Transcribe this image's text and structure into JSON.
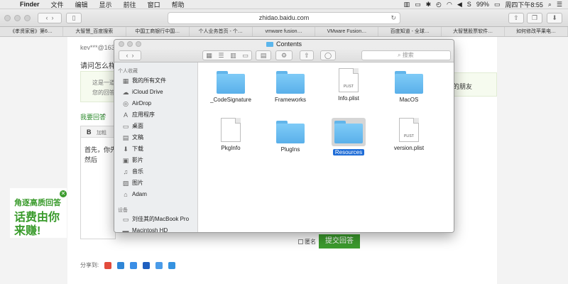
{
  "menubar": {
    "apple_icon": "apple-icon",
    "app_name": "Finder",
    "items": [
      "文件",
      "编辑",
      "显示",
      "前往",
      "窗口",
      "帮助"
    ],
    "battery": "99%",
    "clock": "周四下午8:55"
  },
  "safari": {
    "address": "zhidao.baidu.com",
    "bookmarks": [
      "《孝贤家居》第6…",
      "大智慧_百度搜索",
      "中国工商银行中国…",
      "个人业务首页 - 个…",
      "vmware fusion…",
      "VMware Fusion…",
      "百度知道 - 全球…",
      "大智慧股票软件…",
      "如何修改苹果电…"
    ]
  },
  "page": {
    "user_masked": "kev***@163.c",
    "question": "请问怎么样才",
    "tip_line1": "这是一道",
    "tip_line2": "您的回答",
    "answer_link": "我要回答",
    "bold_btn": "B",
    "bold_label": "加粗",
    "editor_line1": "首先，你先",
    "editor_line2": "然后",
    "right_text": "的朋友",
    "anonymous_label": "匿名",
    "submit_label": "提交回答",
    "share_label": "分享到:"
  },
  "promo": {
    "line1": "角逐高质回答",
    "line2": "话费由你",
    "line3": "来赚!"
  },
  "finder": {
    "title": "Contents",
    "search_placeholder": "搜索",
    "sidebar": {
      "favorites_header": "个人收藏",
      "favorites": [
        {
          "label": "我的所有文件",
          "icon": "all-files-icon",
          "glyph": "▦"
        },
        {
          "label": "iCloud Drive",
          "icon": "cloud-icon",
          "glyph": "☁"
        },
        {
          "label": "AirDrop",
          "icon": "airdrop-icon",
          "glyph": "◎"
        },
        {
          "label": "应用程序",
          "icon": "applications-icon",
          "glyph": "A"
        },
        {
          "label": "桌面",
          "icon": "desktop-icon",
          "glyph": "▭"
        },
        {
          "label": "文稿",
          "icon": "documents-icon",
          "glyph": "▤"
        },
        {
          "label": "下载",
          "icon": "downloads-icon",
          "glyph": "⬇"
        },
        {
          "label": "影片",
          "icon": "movies-icon",
          "glyph": "▣"
        },
        {
          "label": "音乐",
          "icon": "music-icon",
          "glyph": "♫"
        },
        {
          "label": "图片",
          "icon": "pictures-icon",
          "glyph": "▨"
        },
        {
          "label": "Adam",
          "icon": "home-icon",
          "glyph": "⌂"
        }
      ],
      "devices_header": "设备",
      "devices": [
        {
          "label": "刘佳其的MacBook Pro",
          "icon": "laptop-icon",
          "glyph": "▭"
        },
        {
          "label": "Macintosh HD",
          "icon": "disk-icon",
          "glyph": "▬"
        }
      ]
    },
    "files": [
      {
        "name": "_CodeSignature",
        "type": "folder"
      },
      {
        "name": "Frameworks",
        "type": "folder"
      },
      {
        "name": "Info.plist",
        "type": "doc",
        "tag": "PLIST"
      },
      {
        "name": "MacOS",
        "type": "folder"
      },
      {
        "name": "PkgInfo",
        "type": "doc",
        "tag": ""
      },
      {
        "name": "PlugIns",
        "type": "folder"
      },
      {
        "name": "Resources",
        "type": "folder",
        "selected": true
      },
      {
        "name": "version.plist",
        "type": "doc",
        "tag": "PLIST"
      }
    ]
  }
}
